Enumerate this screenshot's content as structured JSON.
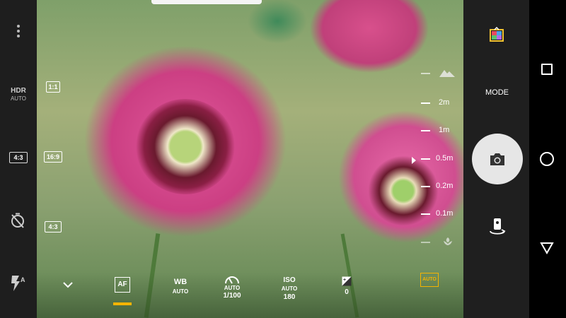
{
  "left_sidebar": {
    "hdr_label": "HDR",
    "hdr_value": "AUTO",
    "aspect_label": "4:3"
  },
  "aspect_column": [
    "1:1",
    "16:9",
    "4:3"
  ],
  "focus_scale": [
    "2m",
    "1m",
    "0.5m",
    "0.2m",
    "0.1m"
  ],
  "bottom_bar": {
    "af_label": "AF",
    "wb_label": "WB",
    "wb_value": "AUTO",
    "shutter_label": "AUTO",
    "shutter_value": "1/100",
    "iso_label": "ISO",
    "iso_sub": "AUTO",
    "iso_value": "180",
    "ev_value": "0",
    "auto_badge": "AUTO"
  },
  "right_panel": {
    "mode_label": "MODE"
  },
  "colors": {
    "accent": "#f5b400",
    "panel": "#1f1f1f",
    "shutter_bg": "#e6e6e6"
  }
}
